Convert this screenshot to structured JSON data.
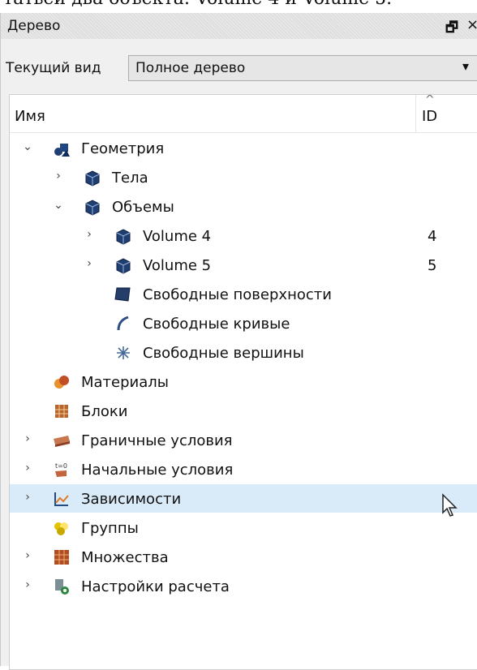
{
  "document_strip": "татьей два объекта: Volume 4 и Volume 5.",
  "panel": {
    "title": "Дерево",
    "float_glyph": "🗗",
    "close_glyph": "×",
    "view_label": "Текущий вид",
    "view_value": "Полное дерево",
    "view_arrow": "▾"
  },
  "tree": {
    "col_name": "Имя",
    "col_id": "ID",
    "sort_glyph": "^",
    "rows": [
      {
        "label": "Геометрия",
        "id": "",
        "expander": "⌄",
        "icon": "geometry-icon"
      },
      {
        "label": "Тела",
        "id": "",
        "expander": "›",
        "icon": "bodies-icon"
      },
      {
        "label": "Объемы",
        "id": "",
        "expander": "⌄",
        "icon": "volumes-icon"
      },
      {
        "label": "Volume 4",
        "id": "4",
        "expander": "›",
        "icon": "volume-icon"
      },
      {
        "label": "Volume 5",
        "id": "5",
        "expander": "›",
        "icon": "volume-icon"
      },
      {
        "label": "Свободные поверхности",
        "id": "",
        "expander": "",
        "icon": "surface-icon"
      },
      {
        "label": "Свободные кривые",
        "id": "",
        "expander": "",
        "icon": "curve-icon"
      },
      {
        "label": "Свободные вершины",
        "id": "",
        "expander": "",
        "icon": "vertex-icon"
      },
      {
        "label": "Материалы",
        "id": "",
        "expander": "",
        "icon": "materials-icon"
      },
      {
        "label": "Блоки",
        "id": "",
        "expander": "",
        "icon": "blocks-icon"
      },
      {
        "label": "Граничные условия",
        "id": "",
        "expander": "›",
        "icon": "boundary-conditions-icon"
      },
      {
        "label": "Начальные условия",
        "id": "",
        "expander": "›",
        "icon": "initial-conditions-icon"
      },
      {
        "label": "Зависимости",
        "id": "",
        "expander": "›",
        "icon": "dependencies-icon"
      },
      {
        "label": "Группы",
        "id": "",
        "expander": "",
        "icon": "groups-icon"
      },
      {
        "label": "Множества",
        "id": "",
        "expander": "›",
        "icon": "sets-icon"
      },
      {
        "label": "Настройки расчета",
        "id": "",
        "expander": "›",
        "icon": "calc-settings-icon"
      }
    ]
  },
  "colors": {
    "hover": "#d9ebf9",
    "cube": "#1f3f73"
  }
}
